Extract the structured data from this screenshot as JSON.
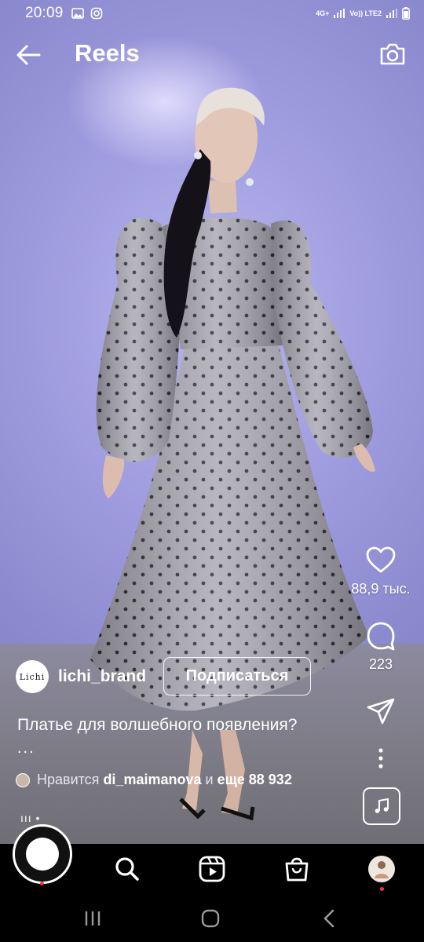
{
  "status_bar": {
    "time": "20:09",
    "network_top": "4G+",
    "network_bottom": "Vo)) LTE2"
  },
  "header": {
    "title": "Reels",
    "back_icon": "arrow-left-icon",
    "camera_icon": "camera-icon"
  },
  "actions": {
    "likes_count": "88,9 тыс.",
    "comments_count": "223",
    "like_icon": "heart-icon",
    "comment_icon": "comment-icon",
    "share_icon": "send-icon",
    "more_icon": "more-vertical-icon",
    "audio_icon": "music-note-icon"
  },
  "post": {
    "avatar_text": "Lichi",
    "username": "lichi_brand",
    "follow_label": "Подписаться",
    "caption": "Платье для волшебного появления?",
    "caption_more": "...",
    "likes_prefix": "Нравится",
    "likes_user": "di_maimanova",
    "likes_and": "и",
    "likes_rest": "еще 88 932",
    "progress_text": "ııı •"
  },
  "bottom_nav": {
    "items": [
      "record",
      "search-icon",
      "reels-icon",
      "shop-icon",
      "profile-avatar"
    ]
  },
  "colors": {
    "background": "#000000",
    "text": "#ffffff",
    "notification_dot": "#ff2d4a",
    "video_wall": "#9d9ade",
    "video_floor": "#7e7d88"
  }
}
